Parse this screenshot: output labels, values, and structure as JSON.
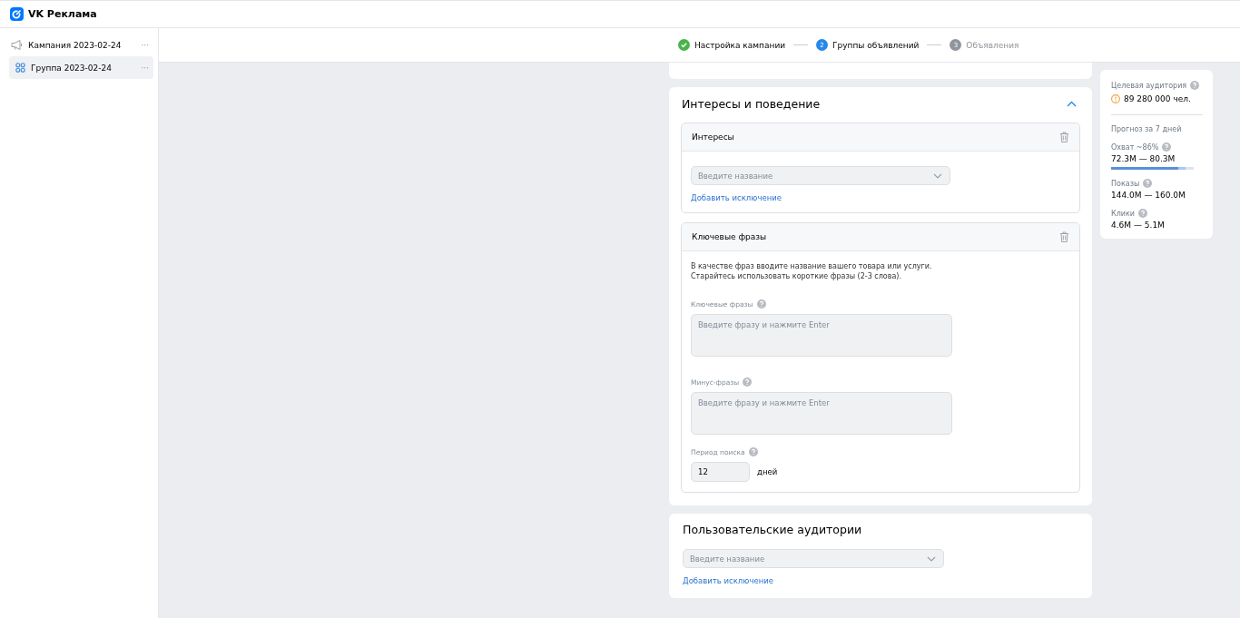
{
  "header": {
    "logo_text": "VK Реклама"
  },
  "sidebar": {
    "items": [
      {
        "kind": "campaign",
        "label": "Кампания 2023-02-24",
        "selected": false,
        "menu": "···"
      },
      {
        "kind": "group",
        "label": "Группа 2023-02-24",
        "selected": true,
        "menu": "···"
      }
    ]
  },
  "stepper": [
    {
      "done": true,
      "selected": false,
      "label": "Настройка кампании"
    },
    {
      "done": false,
      "selected": true,
      "number": "2",
      "label": "Группы объявлений"
    },
    {
      "done": false,
      "selected": false,
      "number": "3",
      "label": "Объявления"
    }
  ],
  "interests_section": {
    "title": "Интересы и поведение",
    "expanded": true,
    "interests": {
      "title": "Интересы",
      "placeholder": "Введите название",
      "link": "Добавить исключение"
    },
    "keywords": {
      "title": "Ключевые фразы",
      "hint_lines": [
        "В качестве фраз вводите название вашего товара или услуги.",
        "Старайтесь использовать короткие фразы (2-3 слова)."
      ],
      "phrases_label": "Ключевые фразы",
      "phrases_placeholder": "Введите фразу и нажмите Enter",
      "minus_label": "Минус-фразы",
      "minus_placeholder": "Введите фразу и нажмите Enter",
      "period_label": "Период поиска",
      "period_value": "12",
      "period_unit": "дней"
    }
  },
  "custom_audiences": {
    "title": "Пользовательские аудитории",
    "placeholder": "Введите название",
    "link": "Добавить исключение"
  },
  "forecast": {
    "audience_label": "Целевая аудитория",
    "audience_value": "89 280 000 чел.",
    "forecast_title": "Прогноз за 7 дней",
    "metrics": [
      {
        "kind": "bar",
        "label": "Охват ~86%",
        "value": "72.3M — 80.3M",
        "level": 0.81
      },
      {
        "kind": "plain",
        "label": "Показы",
        "value": "144.0M — 160.0M"
      },
      {
        "kind": "plain",
        "label": "Клики",
        "value": "4.6M — 5.1M"
      }
    ]
  }
}
